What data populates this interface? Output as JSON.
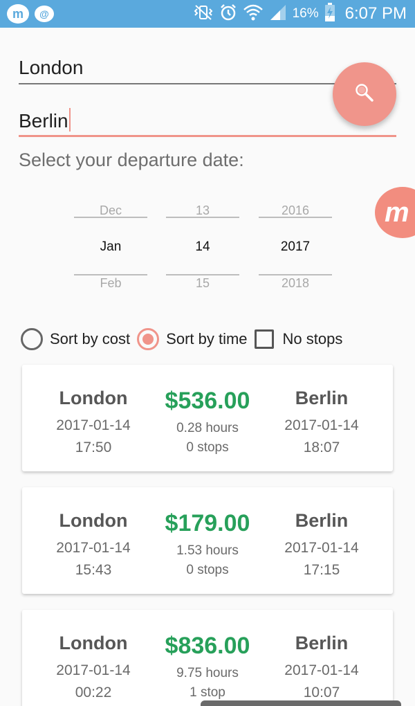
{
  "status_bar": {
    "battery": "16%",
    "time": "6:07 PM",
    "icons": [
      "mu-app-icon",
      "messenger-icon",
      "vibrate-icon",
      "alarm-icon",
      "wifi-icon",
      "signal-icon",
      "battery-charging-icon"
    ]
  },
  "search": {
    "from_value": "London",
    "to_value": "Berlin",
    "button_icon": "search-icon"
  },
  "date": {
    "label": "Select your departure date:",
    "month": {
      "prev": "Dec",
      "selected": "Jan",
      "next": "Feb"
    },
    "day": {
      "prev": "13",
      "selected": "14",
      "next": "15"
    },
    "year": {
      "prev": "2016",
      "selected": "2017",
      "next": "2018"
    }
  },
  "sort": {
    "by_cost": "Sort by cost",
    "by_time": "Sort by time",
    "no_stops": "No stops",
    "selected": "by_time",
    "no_stops_checked": false
  },
  "flights": [
    {
      "from": "London",
      "from_date": "2017-01-14",
      "from_time": "17:50",
      "price": "$536.00",
      "duration": "0.28 hours",
      "stops": "0 stops",
      "to": "Berlin",
      "to_date": "2017-01-14",
      "to_time": "18:07"
    },
    {
      "from": "London",
      "from_date": "2017-01-14",
      "from_time": "15:43",
      "price": "$179.00",
      "duration": "1.53 hours",
      "stops": "0 stops",
      "to": "Berlin",
      "to_date": "2017-01-14",
      "to_time": "17:15"
    },
    {
      "from": "London",
      "from_date": "2017-01-14",
      "from_time": "00:22",
      "price": "$836.00",
      "duration": "9.75 hours",
      "stops": "1 stop",
      "to": "Berlin",
      "to_date": "2017-01-14",
      "to_time": "10:07"
    }
  ],
  "colors": {
    "status_bar": "#5aa9dd",
    "accent": "#f0948a",
    "price_green": "#27a05a",
    "background": "#fafafa"
  }
}
